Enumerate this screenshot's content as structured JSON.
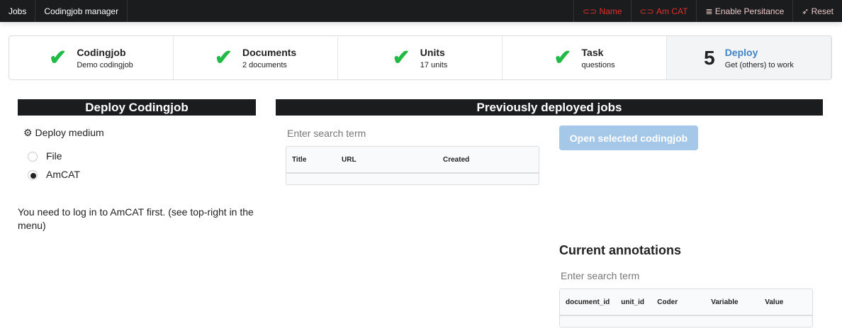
{
  "nav": {
    "left": [
      "Jobs",
      "Codingjob manager"
    ],
    "right": [
      {
        "label": "Name",
        "icon": "link-icon"
      },
      {
        "label": "Am CAT",
        "icon": "link-icon"
      },
      {
        "label": "Enable Persitance",
        "icon": "database-icon"
      },
      {
        "label": "Reset",
        "icon": "rocket-icon"
      }
    ]
  },
  "steps": [
    {
      "title": "Codingjob",
      "desc": "Demo codingjob",
      "done": true
    },
    {
      "title": "Documents",
      "desc": "2 documents",
      "done": true
    },
    {
      "title": "Units",
      "desc": "17 units",
      "done": true
    },
    {
      "title": "Task",
      "desc": "questions",
      "done": true
    },
    {
      "number": "5",
      "title": "Deploy",
      "desc": "Get (others) to work",
      "done": false
    }
  ],
  "deploy": {
    "title": "Deploy Codingjob",
    "medium_label": "Deploy medium",
    "options": [
      "File",
      "AmCAT"
    ],
    "selected": "AmCAT",
    "message": "You need to log in to AmCAT first. (see top-right in the menu)"
  },
  "previous": {
    "title": "Previously deployed jobs",
    "search_placeholder": "Enter search term",
    "columns": [
      "Title",
      "URL",
      "Created"
    ],
    "open_button": "Open selected codingjob"
  },
  "annotations": {
    "title": "Current annotations",
    "search_placeholder": "Enter search term",
    "columns": [
      "document_id",
      "unit_id",
      "Coder",
      "Variable",
      "Value"
    ]
  },
  "colors": {
    "accent": "#4183c4",
    "check": "#21ba45",
    "nav_red": "#e0302a"
  }
}
